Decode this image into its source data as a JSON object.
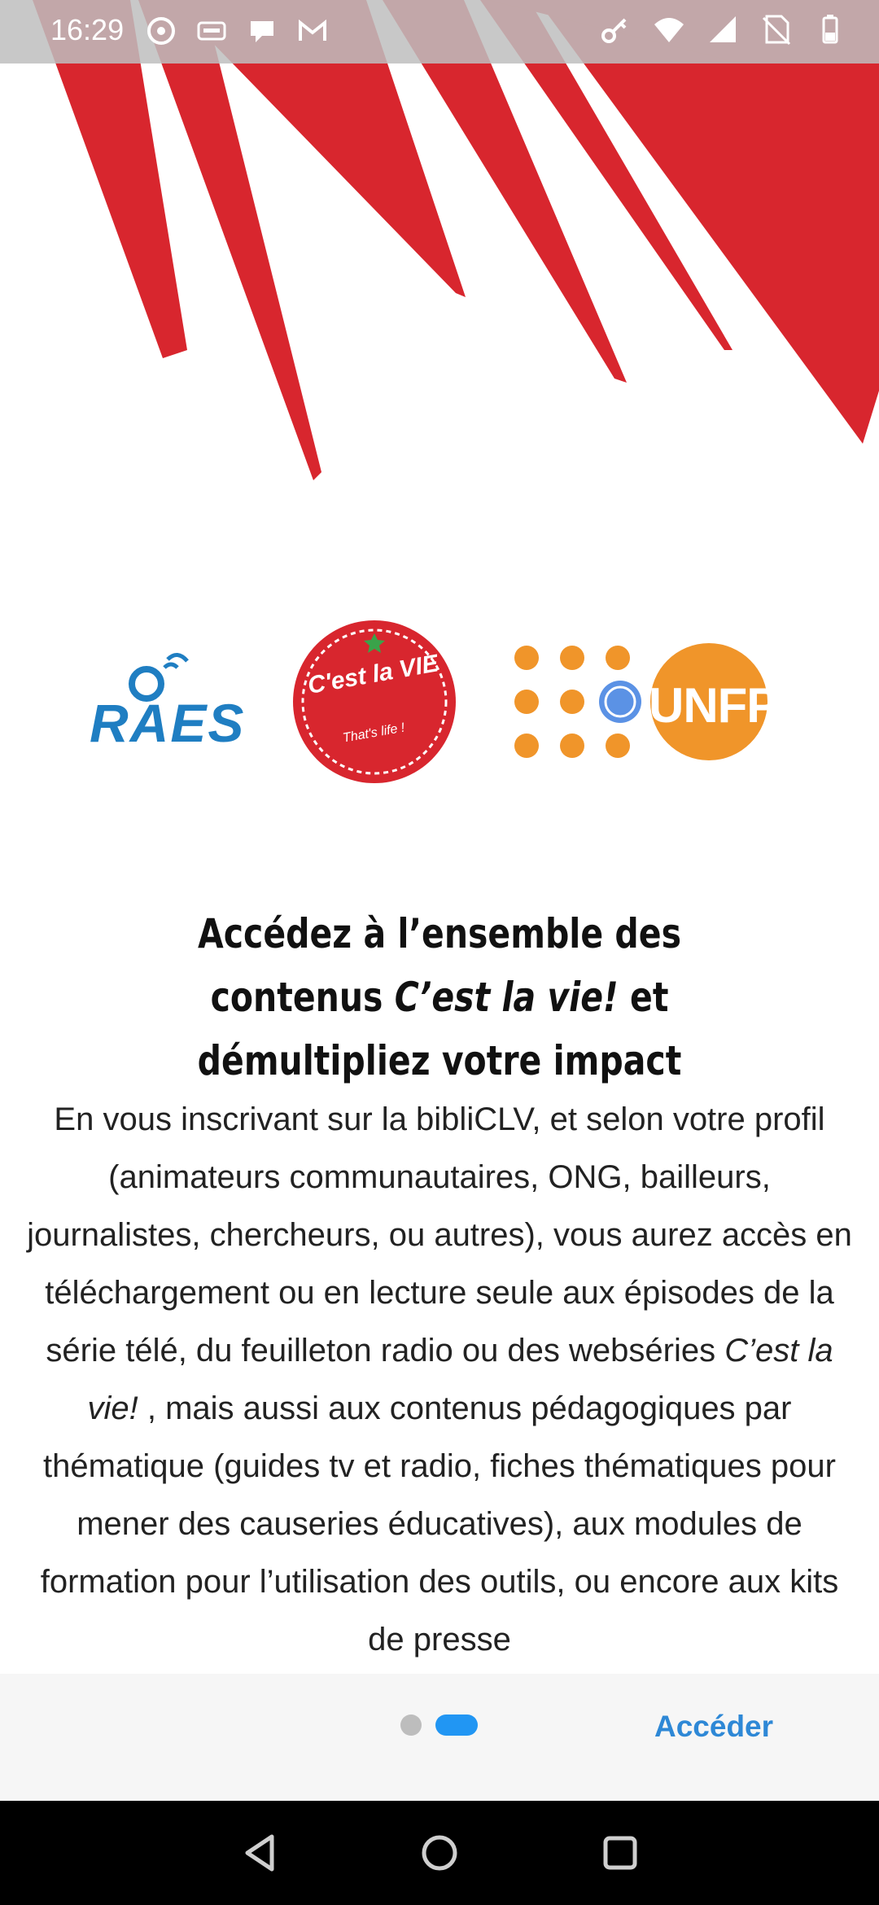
{
  "status_bar": {
    "time": "16:29",
    "left_icons": [
      "chrome-icon",
      "keyboard-icon",
      "chat-icon",
      "gmail-icon"
    ],
    "right_icons": [
      "key-icon",
      "wifi-icon",
      "signal-icon",
      "sim-off-icon",
      "battery-icon"
    ]
  },
  "logos": {
    "raes": "RAES",
    "cest_la_vie": "C'est la VIE",
    "cest_la_vie_tagline": "That's life !",
    "unfpa": "UNFPA"
  },
  "headline": {
    "part1": "Accédez à l’ensemble des contenus ",
    "italic1": "C’est la vie!",
    "part2": " et démultipliez votre impact"
  },
  "body": {
    "part1": "En vous inscrivant sur la bibliCLV, et selon votre profil (animateurs communautaires, ONG, bailleurs, journalistes, chercheurs, ou autres), vous aurez accès en téléchargement ou en lecture seule aux épisodes de la série télé, du feuilleton radio ou des webséries ",
    "italic": "C’est la vie!",
    "part2": " , mais aussi aux contenus pédagogiques par thématique (guides tv et radio, fiches thématiques pour mener des causeries éducatives), aux modules de formation pour l’utilisation des outils, ou encore aux kits de presse"
  },
  "pager": {
    "total": 2,
    "current": 2
  },
  "actions": {
    "access_label": "Accéder"
  },
  "colors": {
    "accent": "#2196f3",
    "banner_red": "#d8262e",
    "raes_blue": "#1f7ec2",
    "unfpa_orange": "#f0952a"
  },
  "nav": [
    "back-icon",
    "home-icon",
    "recents-icon"
  ]
}
